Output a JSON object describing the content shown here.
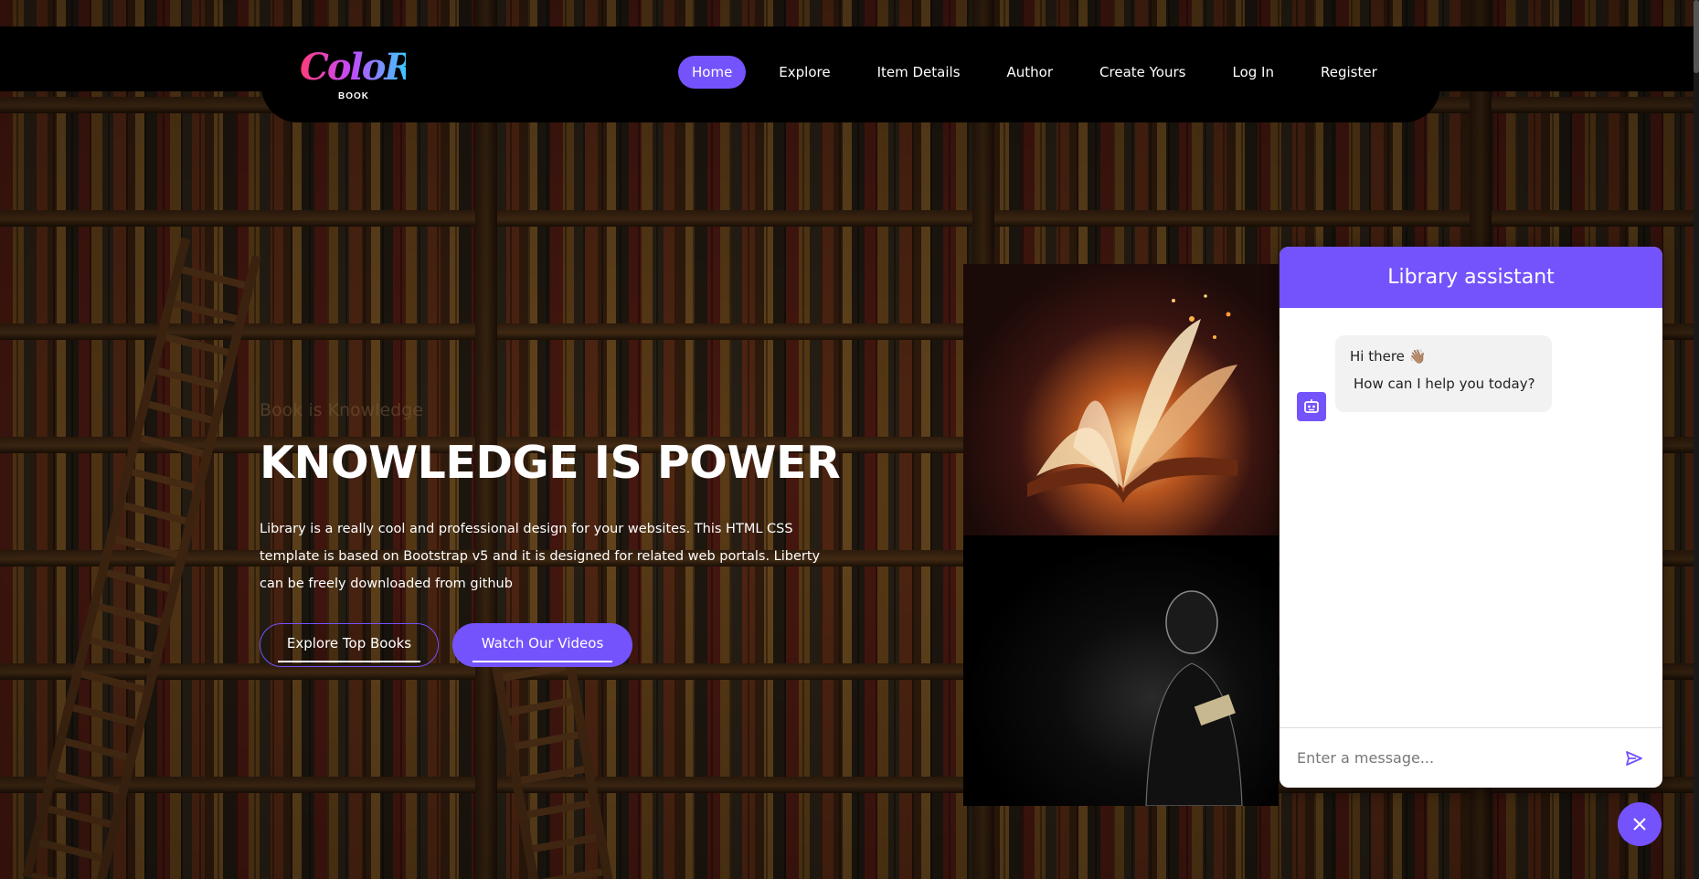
{
  "brand": {
    "logo_text": "ColoR",
    "logo_sub": "BOOK"
  },
  "nav": {
    "items": [
      {
        "label": "Home",
        "active": true
      },
      {
        "label": "Explore",
        "active": false
      },
      {
        "label": "Item Details",
        "active": false
      },
      {
        "label": "Author",
        "active": false
      },
      {
        "label": "Create Yours",
        "active": false
      },
      {
        "label": "Log In",
        "active": false
      },
      {
        "label": "Register",
        "active": false
      }
    ]
  },
  "hero": {
    "kicker": "Book is Knowledge",
    "title": "KNOWLEDGE IS POWER",
    "description": "Library is a really cool and professional design for your websites. This HTML CSS template is based on Bootstrap v5 and it is designed for related web portals. Liberty can be freely downloaded from github",
    "primary_button": "Explore Top Books",
    "secondary_button": "Watch Our Videos"
  },
  "chat": {
    "title": "Library assistant",
    "messages": [
      {
        "from": "bot",
        "line1": "Hi there 👋🏽",
        "line2": "How can I help you today?"
      }
    ],
    "input_placeholder": "Enter a message...",
    "icons": {
      "avatar": "robot-icon",
      "send": "send-icon",
      "close": "close-icon"
    }
  },
  "colors": {
    "accent": "#7453fc",
    "header_bg": "#000000"
  }
}
